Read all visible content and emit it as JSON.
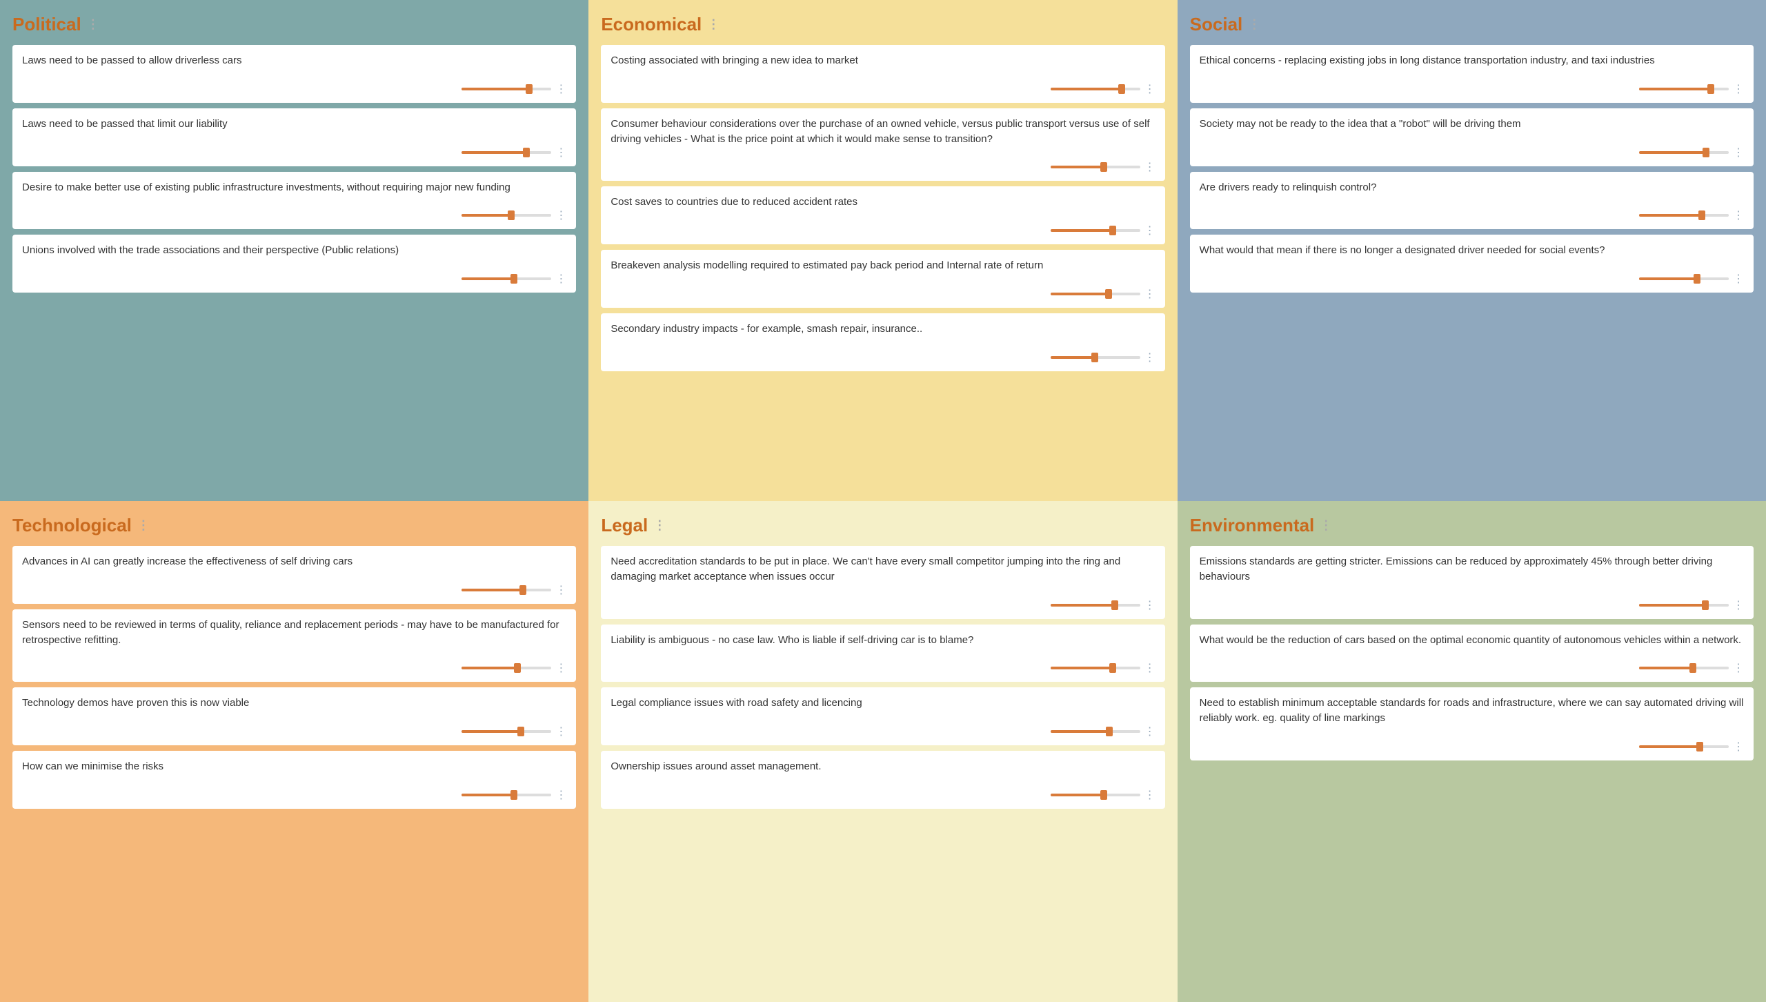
{
  "categories": [
    {
      "id": "political",
      "label": "Political",
      "class": "political",
      "cards": [
        {
          "text": "Laws need to be passed to allow driverless cars",
          "fill": 75
        },
        {
          "text": "Laws need to be passed that limit our liability",
          "fill": 72
        },
        {
          "text": "Desire to make better use of existing public infrastructure investments, without requiring major new funding",
          "fill": 55
        },
        {
          "text": "Unions involved with the trade associations and their perspective (Public relations)",
          "fill": 58
        }
      ]
    },
    {
      "id": "economical",
      "label": "Economical",
      "class": "economical",
      "cards": [
        {
          "text": "Costing associated with bringing a new idea to market",
          "fill": 80
        },
        {
          "text": "Consumer behaviour considerations over the purchase of an owned vehicle, versus public transport versus use of self driving vehicles - What is the price point at which it would make sense to transition?",
          "fill": 60
        },
        {
          "text": "Cost saves to countries due to reduced accident rates",
          "fill": 70
        },
        {
          "text": "Breakeven analysis modelling required to estimated pay back period and Internal rate of return",
          "fill": 65
        },
        {
          "text": "Secondary industry impacts - for example, smash repair, insurance..",
          "fill": 50
        }
      ]
    },
    {
      "id": "social",
      "label": "Social",
      "class": "social",
      "cards": [
        {
          "text": "Ethical concerns - replacing existing jobs in long distance transportation industry, and taxi industries",
          "fill": 80
        },
        {
          "text": "Society may not be ready to the idea that a \"robot\" will be driving them",
          "fill": 75
        },
        {
          "text": "Are drivers ready to relinquish control?",
          "fill": 70
        },
        {
          "text": "What would that mean if there is no longer a designated driver needed for social events?",
          "fill": 65
        }
      ]
    },
    {
      "id": "technological",
      "label": "Technological",
      "class": "technological",
      "cards": [
        {
          "text": "Advances in AI can greatly increase the effectiveness of self driving cars",
          "fill": 68
        },
        {
          "text": "Sensors need to be reviewed in terms of quality, reliance and replacement periods - may have to be manufactured for retrospective refitting.",
          "fill": 62
        },
        {
          "text": "Technology demos have proven this is now viable",
          "fill": 66
        },
        {
          "text": "How can we minimise the risks",
          "fill": 58
        }
      ]
    },
    {
      "id": "legal",
      "label": "Legal",
      "class": "legal",
      "cards": [
        {
          "text": "Need accreditation standards to be put in place. We can't have every small competitor jumping into the ring and damaging market acceptance when issues occur",
          "fill": 72
        },
        {
          "text": "Liability is ambiguous - no case law. Who is liable if self-driving car is to blame?",
          "fill": 70
        },
        {
          "text": "Legal compliance issues with road safety and licencing",
          "fill": 66
        },
        {
          "text": "Ownership issues around asset management.",
          "fill": 60
        }
      ]
    },
    {
      "id": "environmental",
      "label": "Environmental",
      "class": "environmental",
      "cards": [
        {
          "text": "Emissions standards are getting stricter. Emissions can be reduced by approximately 45% through better driving behaviours",
          "fill": 74
        },
        {
          "text": "What would be the reduction of cars based on the optimal economic quantity of autonomous vehicles within a network.",
          "fill": 60
        },
        {
          "text": "Need to establish minimum acceptable standards for roads and infrastructure, where we can say automated driving will reliably work. eg. quality of line markings",
          "fill": 68
        }
      ]
    }
  ],
  "drag_handle_char": "⋮",
  "dots_char": "⋮"
}
